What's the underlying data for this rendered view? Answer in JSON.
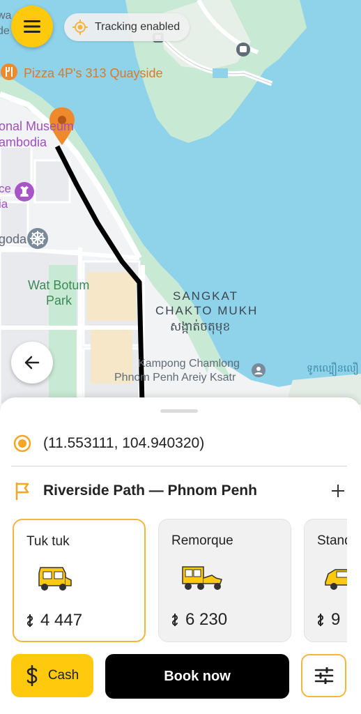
{
  "header": {
    "menu_icon": "hamburger-menu-icon",
    "tracking_label": "Tracking enabled",
    "tracking_icon": "location-target-icon"
  },
  "map": {
    "labels": {
      "poi_pizza": "Pizza 4P's 313 Quayside",
      "poi_museum_line1": "onal Museum",
      "poi_museum_line2": "ambodia",
      "partial_top": "wa",
      "partial_top2": "de",
      "partial_ce": "ce",
      "partial_ia": "ia",
      "poi_pagoda": "goda",
      "park_line1": "Wat Botum",
      "park_line2": "Park",
      "district_line1": "SANGKAT",
      "district_line2": "CHAKTO MUKH",
      "district_khmer": "សង្កាត់ចតុមុខ",
      "place_line1": "Kampong Chamlong",
      "place_line2": "Phnom Penh Areiy Ksatr",
      "khmer_right": "ទូកល្បឿនលឿ"
    },
    "colors": {
      "water": "#8fd3ea",
      "park": "#c8ead4",
      "land": "#f1f3f4",
      "route": "#000000",
      "pin": "#ee8a2b"
    }
  },
  "back_icon": "arrow-left-icon",
  "sheet": {
    "origin_icon": "origin-dot-icon",
    "origin_coords": "(11.553111, 104.940320)",
    "destination_icon": "flag-icon",
    "destination": "Riverside Path — Phnom Penh",
    "add_icon": "plus-icon",
    "vehicles": [
      {
        "name": "Tuk tuk",
        "price": "4 447",
        "currency_icon": "riel-icon",
        "selected": true
      },
      {
        "name": "Remorque",
        "price": "6 230",
        "currency_icon": "riel-icon",
        "selected": false
      },
      {
        "name": "Standard",
        "price": "9",
        "currency_icon": "riel-icon",
        "selected": false
      }
    ]
  },
  "actions": {
    "cash_label": "Cash",
    "cash_icon": "dollar-icon",
    "book_label": "Book now",
    "filter_icon": "sliders-icon"
  },
  "accent": "#ffc90e"
}
